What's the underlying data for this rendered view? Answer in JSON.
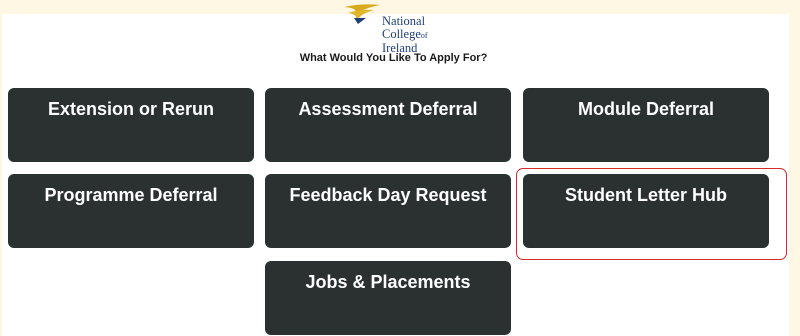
{
  "logo": {
    "line1": "National",
    "line2": "College",
    "line2_suffix": "of",
    "line3": "Ireland",
    "colors": {
      "gold": "#d9a91c",
      "navy": "#1e3f7a"
    }
  },
  "page": {
    "subtitle": "What Would You Like To Apply For?"
  },
  "tiles": [
    {
      "label": "Extension or Rerun"
    },
    {
      "label": "Assessment Deferral"
    },
    {
      "label": "Module Deferral"
    },
    {
      "label": "Programme Deferral"
    },
    {
      "label": "Feedback Day Request"
    },
    {
      "label": "Student Letter Hub",
      "highlighted": true
    },
    {
      "label": "Jobs & Placements"
    }
  ],
  "colors": {
    "background": "#fdf7e4",
    "panel": "#ffffff",
    "tile": "#2b3131",
    "tile_text": "#ffffff",
    "highlight": "#d62b2b"
  }
}
